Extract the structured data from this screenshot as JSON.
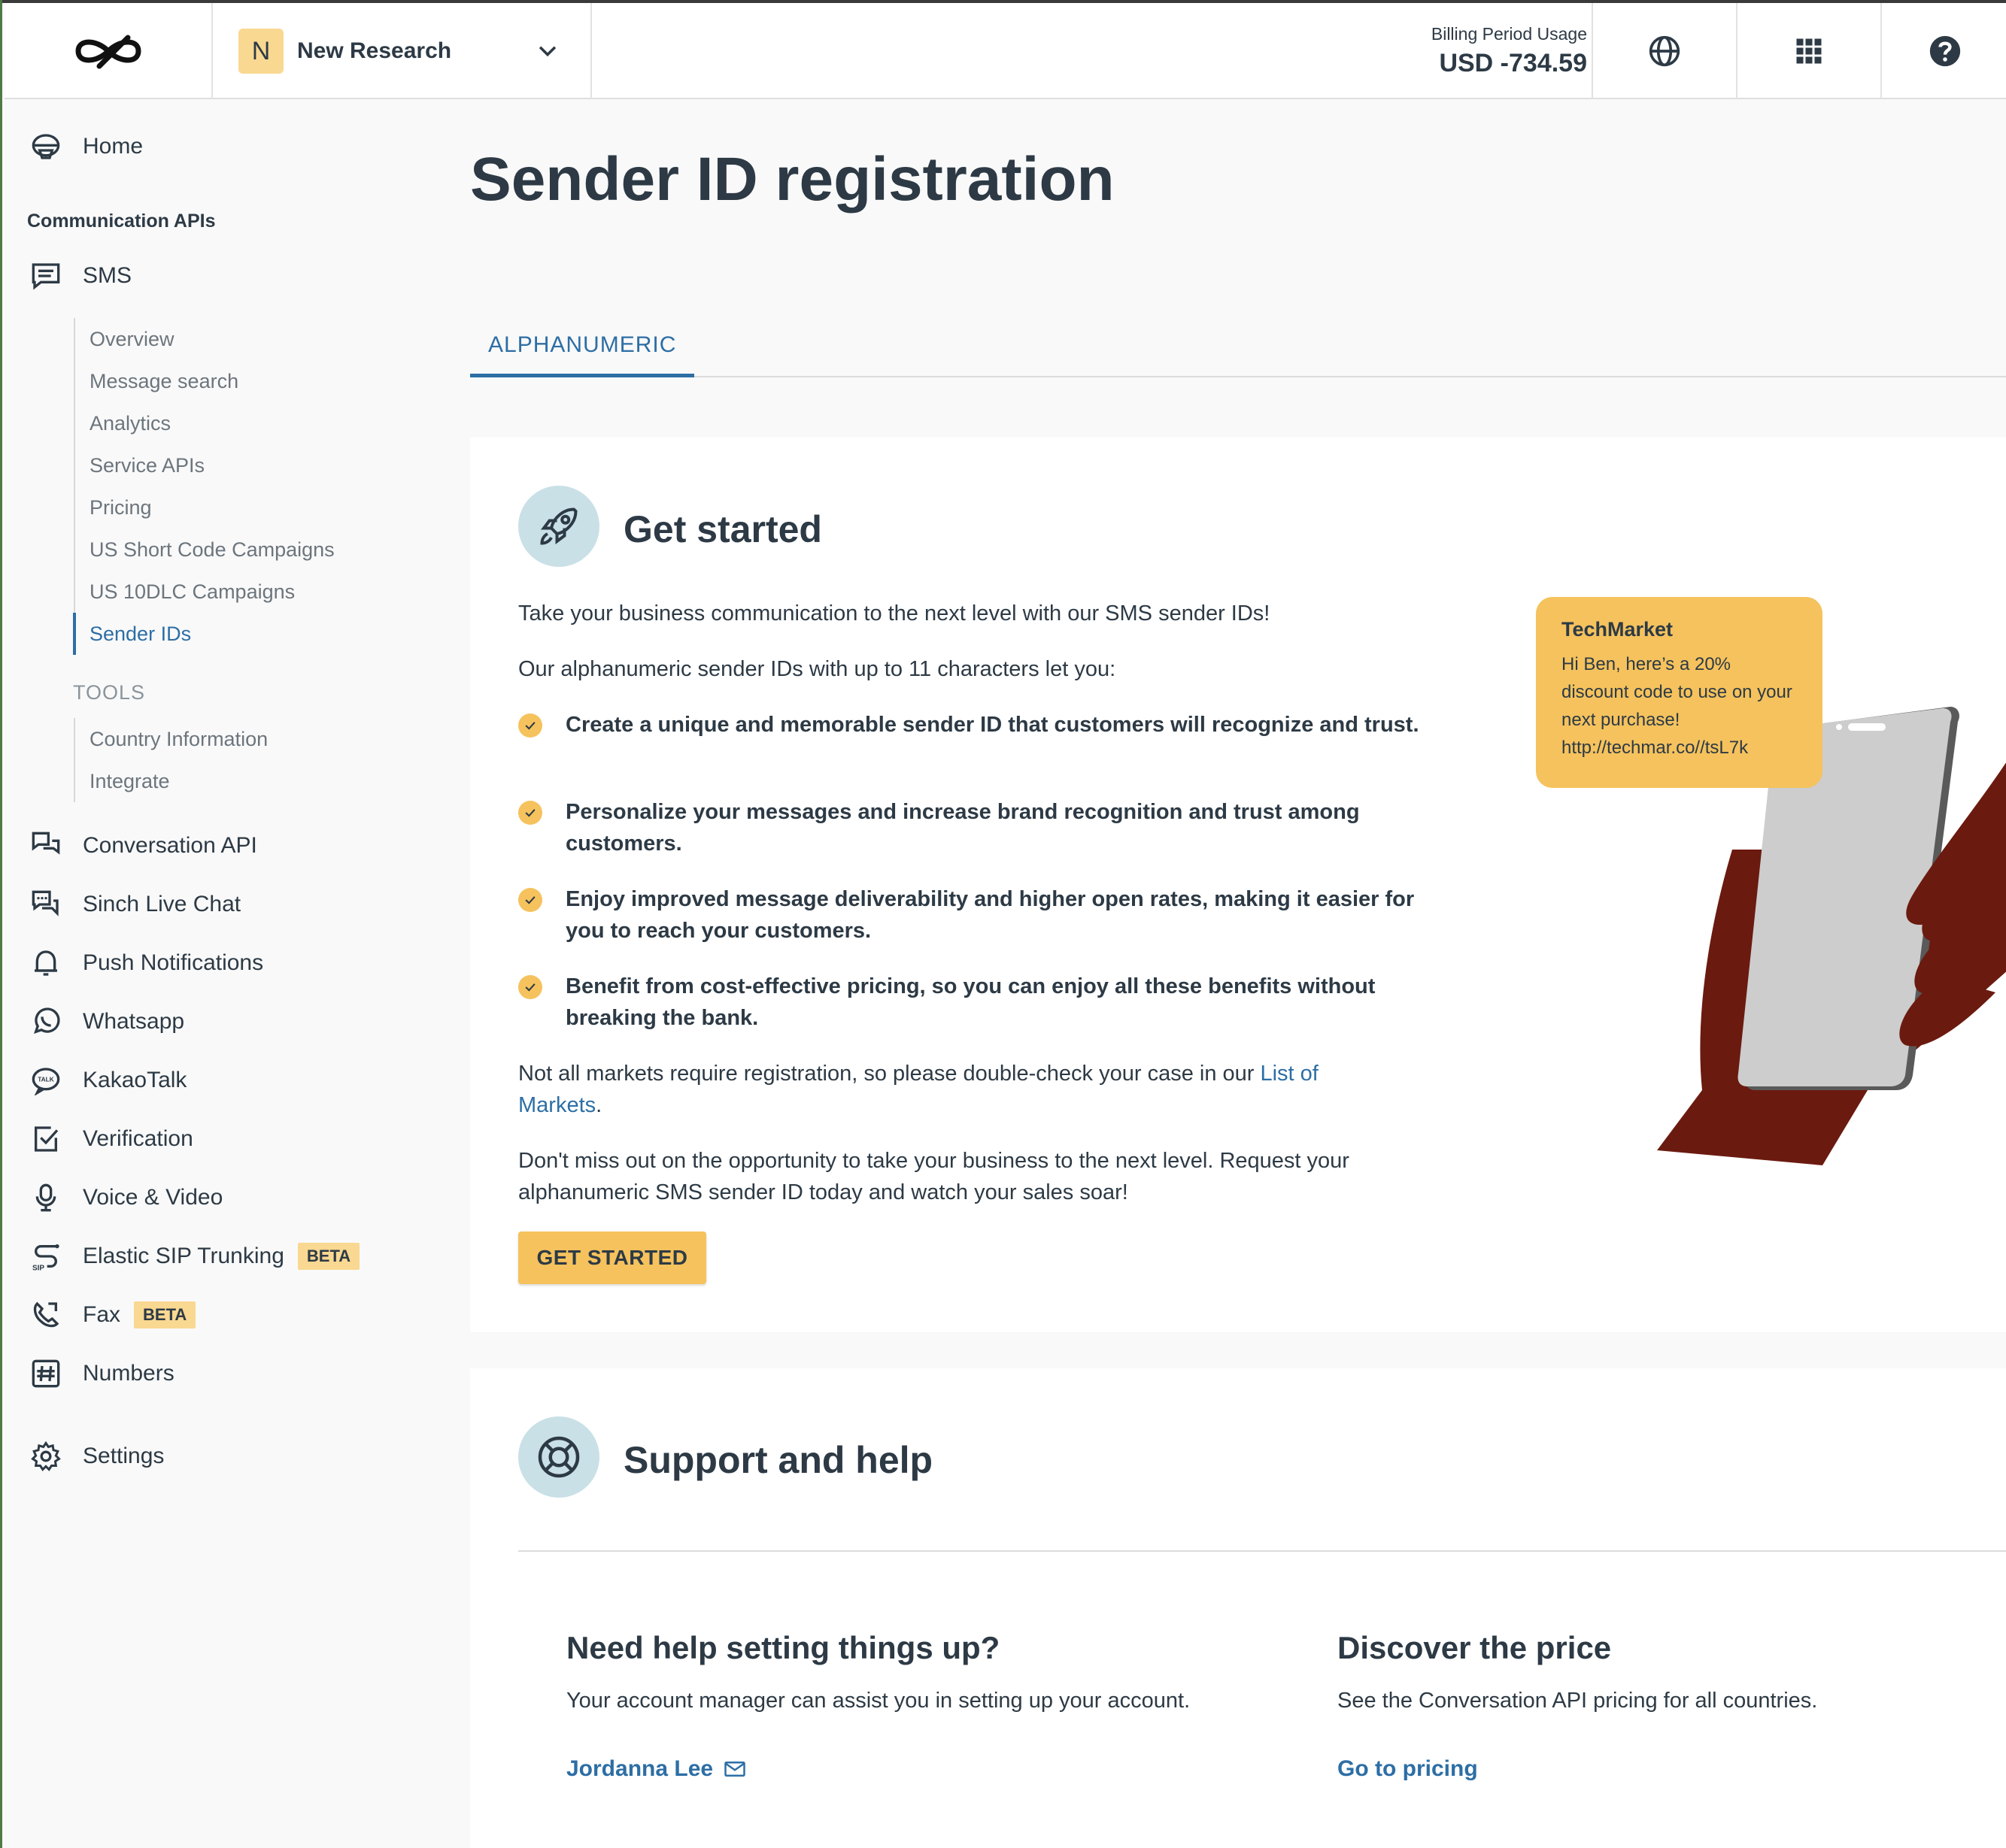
{
  "header": {
    "project_initial": "N",
    "project_name": "New Research",
    "billing_label": "Billing Period Usage",
    "billing_value": "USD -734.59"
  },
  "sidebar": {
    "home": "Home",
    "section_label": "Communication APIs",
    "sms": "SMS",
    "sms_items": [
      "Overview",
      "Message search",
      "Analytics",
      "Service APIs",
      "Pricing",
      "US Short Code Campaigns",
      "US 10DLC Campaigns",
      "Sender IDs"
    ],
    "tools_label": "TOOLS",
    "tools_items": [
      "Country Information",
      "Integrate"
    ],
    "conversation_api": "Conversation API",
    "live_chat": "Sinch Live Chat",
    "push": "Push Notifications",
    "whatsapp": "Whatsapp",
    "kakaotalk": "KakaoTalk",
    "verification": "Verification",
    "voice_video": "Voice & Video",
    "elastic_sip": "Elastic SIP Trunking",
    "fax": "Fax",
    "beta_label": "BETA",
    "numbers": "Numbers",
    "settings": "Settings"
  },
  "main": {
    "title": "Sender ID registration",
    "tab": "ALPHANUMERIC",
    "get_started": {
      "title": "Get started",
      "intro": "Take your business communication to the next level with our SMS sender IDs!",
      "intro2": "Our alphanumeric sender IDs with up to 11 characters let you:",
      "bullets": [
        "Create a unique and memorable sender ID that customers will recognize and trust.",
        "Personalize your messages and increase brand recognition and trust among customers.",
        "Enjoy improved message deliverability and higher open rates, making it easier for you to reach your customers.",
        "Benefit from cost-effective pricing, so you can enjoy all these benefits without breaking the bank."
      ],
      "markets_text": "Not all markets require registration, so please double-check your case in our ",
      "markets_link": "List of Markets",
      "markets_end": ".",
      "closing": "Don't miss out on the opportunity to take your business to the next level. Request your alphanumeric SMS sender ID today and watch your sales soar!",
      "button": "GET STARTED",
      "bubble_title": "TechMarket",
      "bubble_text": "Hi Ben, here’s a 20% discount code to use on your next purchase! http://techmar.co//tsL7k"
    },
    "support": {
      "title": "Support and help",
      "help_title": "Need help setting things up?",
      "help_text": "Your account manager can assist you in setting up your account.",
      "help_link": "Jordanna Lee",
      "price_title": "Discover the price",
      "price_text": "See the Conversation API pricing for all countries.",
      "price_link": "Go to pricing"
    }
  },
  "colors": {
    "accent_blue": "#2d6ea5",
    "accent_yellow": "#f5c25d",
    "hand": "#6b1a0f",
    "icon_circle": "#c9e0e6"
  }
}
